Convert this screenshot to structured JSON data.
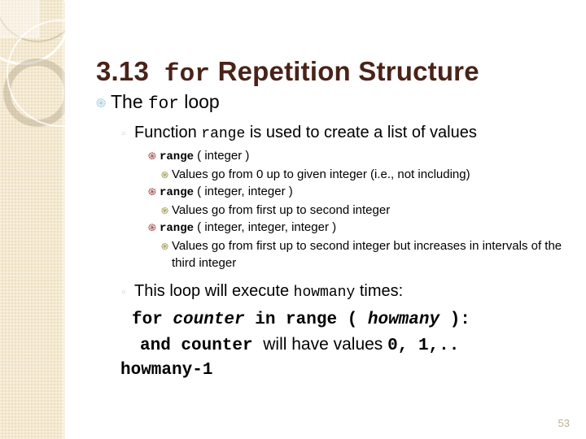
{
  "slide": {
    "title_number": "3.13",
    "title_mono": "for",
    "title_rest": "Repetition Structure",
    "page_number": "53"
  },
  "colors": {
    "title": "#4a2318",
    "band_background": "#f2e4c4",
    "bullet_level1": "#9ec8d8",
    "bullet_level2": "#a7c4d2",
    "bullet_level3": "#8c2a2a",
    "bullet_level4": "#8d8b33",
    "page_number": "#b9b58d",
    "body_text": "#000000"
  },
  "bullets": {
    "glyph_level1": "֍",
    "glyph_level2": "◦",
    "glyph_level3": "֍",
    "glyph_level4": "֍"
  },
  "level1": {
    "pre": "The ",
    "mono": "for",
    "post": " loop"
  },
  "section_range": {
    "heading": {
      "pre": "Function ",
      "mono": "range",
      "post": " is used to create a list of values"
    },
    "items": [
      {
        "name": "range",
        "signature": " ( integer )",
        "description": "Values go from 0 up to given integer (i.e., not including)"
      },
      {
        "name": "range",
        "signature": " ( integer, integer )",
        "description": "Values go from first up to second integer"
      },
      {
        "name": "range",
        "signature": " ( integer, integer, integer )",
        "description": "Values go from first up to second integer but increases in intervals of the third integer"
      }
    ]
  },
  "section_loop": {
    "heading": {
      "pre": "This loop will execute ",
      "mono": "howmany",
      "post": " times:"
    },
    "code": {
      "line1_a": "for ",
      "line1_b": "counter",
      "line1_c": " in range ( ",
      "line1_d": "howmany",
      "line1_e": " ):",
      "line2_a": "and counter ",
      "line2_b": "will have values ",
      "line2_c": "0, 1,..",
      "line3": "howmany-1"
    }
  }
}
